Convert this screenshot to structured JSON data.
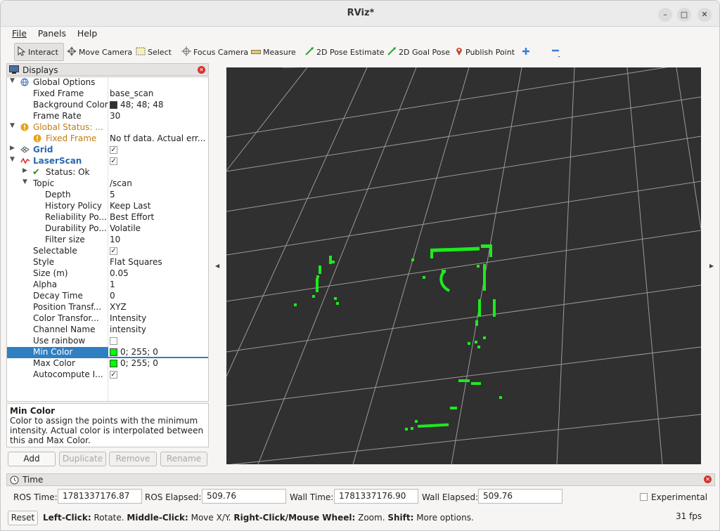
{
  "window": {
    "title": "RViz*"
  },
  "menu": [
    "File",
    "Panels",
    "Help"
  ],
  "toolbar": {
    "interact": "Interact",
    "move_camera": "Move Camera",
    "select": "Select",
    "focus_camera": "Focus Camera",
    "measure": "Measure",
    "pose_estimate": "2D Pose Estimate",
    "goal_pose": "2D Goal Pose",
    "publish_point": "Publish Point"
  },
  "displays": {
    "title": "Displays",
    "rows": [
      {
        "key": "Global Options",
        "value": ""
      },
      {
        "key": "Fixed Frame",
        "value": "base_scan"
      },
      {
        "key": "Background Color",
        "value": "48; 48; 48",
        "swatch": "#303030"
      },
      {
        "key": "Frame Rate",
        "value": "30"
      },
      {
        "key": "Global Status: ...",
        "value": ""
      },
      {
        "key": "Fixed Frame",
        "value": "No tf data.  Actual err..."
      },
      {
        "key": "Grid",
        "value": "",
        "checked": true
      },
      {
        "key": "LaserScan",
        "value": "",
        "checked": true
      },
      {
        "key": "Status: Ok",
        "value": ""
      },
      {
        "key": "Topic",
        "value": "/scan"
      },
      {
        "key": "Depth",
        "value": "5"
      },
      {
        "key": "History Policy",
        "value": "Keep Last"
      },
      {
        "key": "Reliability Po...",
        "value": "Best Effort"
      },
      {
        "key": "Durability Po...",
        "value": "Volatile"
      },
      {
        "key": "Filter size",
        "value": "10"
      },
      {
        "key": "Selectable",
        "value": "",
        "checked": true
      },
      {
        "key": "Style",
        "value": "Flat Squares"
      },
      {
        "key": "Size (m)",
        "value": "0.05"
      },
      {
        "key": "Alpha",
        "value": "1"
      },
      {
        "key": "Decay Time",
        "value": "0"
      },
      {
        "key": "Position Transf...",
        "value": "XYZ"
      },
      {
        "key": "Color Transfor...",
        "value": "Intensity"
      },
      {
        "key": "Channel Name",
        "value": "intensity"
      },
      {
        "key": "Use rainbow",
        "value": "",
        "checked": false
      },
      {
        "key": "Min Color",
        "value": "0; 255; 0",
        "swatch": "#00ff00"
      },
      {
        "key": "Max Color",
        "value": "0; 255; 0",
        "swatch": "#00ff00"
      },
      {
        "key": "Autocompute I...",
        "value": "",
        "checked": true
      }
    ],
    "description": {
      "title": "Min Color",
      "text": "Color to assign the points with the minimum intensity.  Actual color is interpolated between this and Max Color."
    },
    "buttons": {
      "add": "Add",
      "duplicate": "Duplicate",
      "remove": "Remove",
      "rename": "Rename"
    }
  },
  "viewport": {
    "background": "#303030",
    "grid_color": "#a0a0a0",
    "scan_color": "#00ff00"
  },
  "time": {
    "title": "Time",
    "ros_time_label": "ROS Time:",
    "ros_time": "1781337176.87",
    "ros_elapsed_label": "ROS Elapsed:",
    "ros_elapsed": "509.76",
    "wall_time_label": "Wall Time:",
    "wall_time": "1781337176.90",
    "wall_elapsed_label": "Wall Elapsed:",
    "wall_elapsed": "509.76",
    "experimental": "Experimental"
  },
  "status": {
    "reset": "Reset",
    "left_click_b": "Left-Click:",
    "left_click": " Rotate. ",
    "middle_click_b": "Middle-Click:",
    "middle_click": " Move X/Y. ",
    "right_click_b": "Right-Click/Mouse Wheel:",
    "right_click": " Zoom. ",
    "shift_b": "Shift:",
    "shift": " More options.",
    "fps": "31 fps"
  }
}
